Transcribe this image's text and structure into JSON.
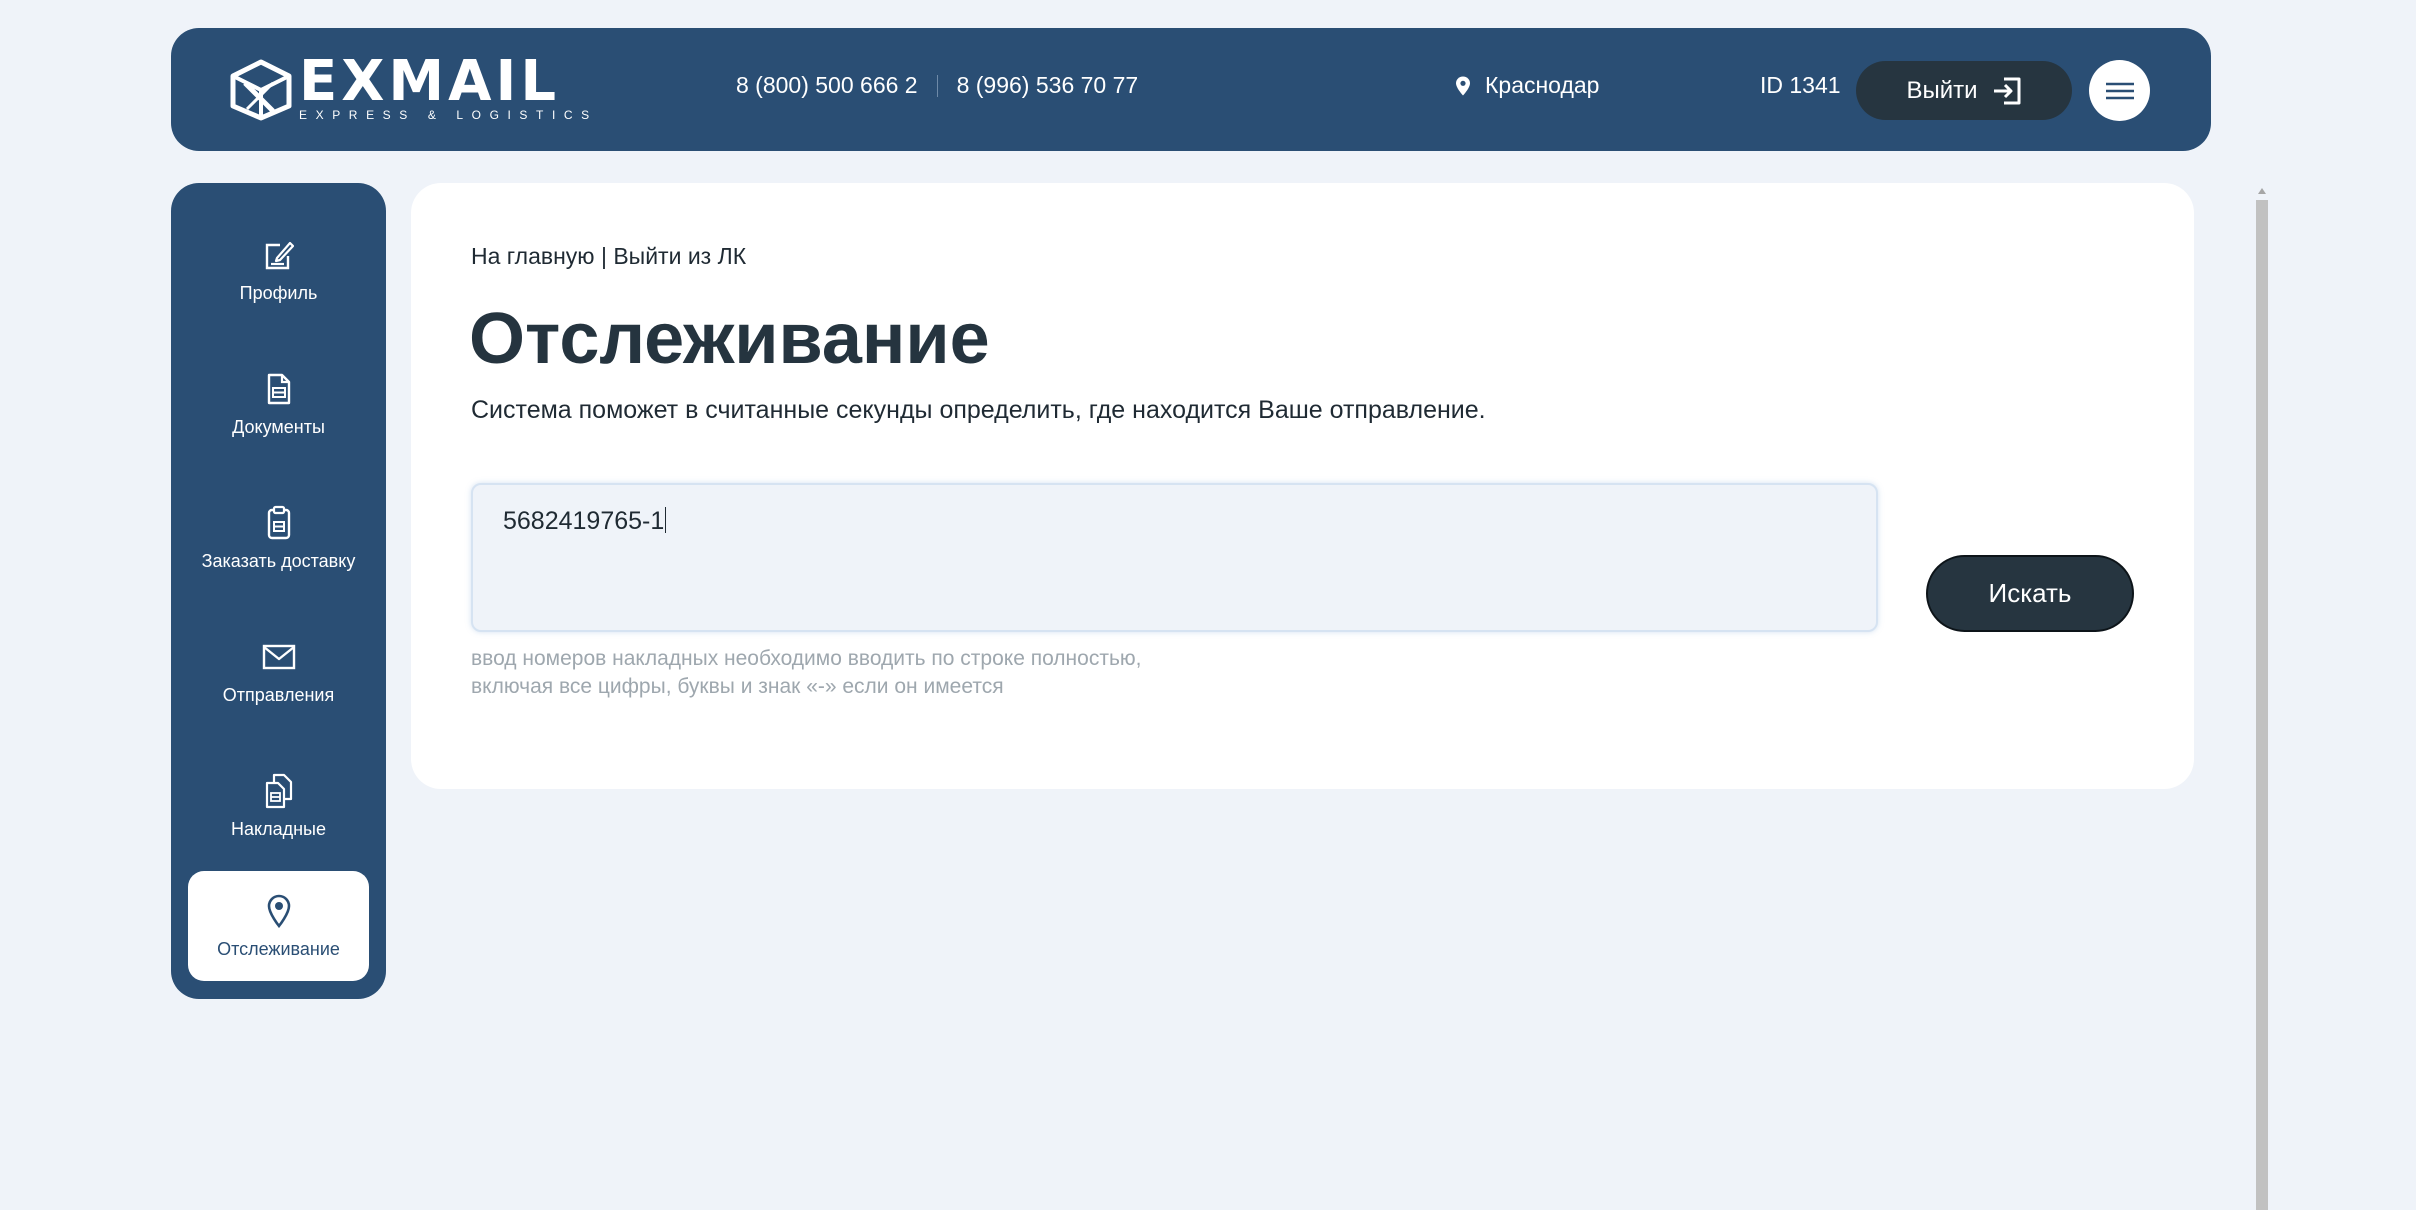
{
  "header": {
    "logo_text": "EXMAIL",
    "logo_subtitle": "EXPRESS & LOGISTICS",
    "phone_1": "8 (800) 500 666 2",
    "phone_2": "8 (996) 536 70 77",
    "city": "Краснодар",
    "user_id": "ID 1341",
    "logout_label": "Выйти",
    "icons": {
      "logo": "box-logo-icon",
      "city": "location-pin-icon",
      "logout": "logout-icon",
      "menu": "hamburger-menu-icon"
    }
  },
  "sidebar": {
    "items": [
      {
        "label": "Профиль",
        "icon": "edit-icon",
        "active": false
      },
      {
        "label": "Документы",
        "icon": "document-icon",
        "active": false
      },
      {
        "label": "Заказать доставку",
        "icon": "clipboard-icon",
        "active": false
      },
      {
        "label": "Отправления",
        "icon": "envelope-icon",
        "active": false
      },
      {
        "label": "Накладные",
        "icon": "invoices-icon",
        "active": false
      },
      {
        "label": "Отслеживание",
        "icon": "location-pin-icon",
        "active": true
      }
    ]
  },
  "main": {
    "breadcrumb_home": "На главную",
    "breadcrumb_sep": "|",
    "breadcrumb_logout": "Выйти из ЛК",
    "title": "Отслеживание",
    "subtitle": "Система поможет в считанные секунды определить, где находится Ваше отправление.",
    "search_value": "5682419765-1",
    "hint_line_1": "ввод номеров накладных необходимо вводить по строке полностью,",
    "hint_line_2": "включая все цифры, буквы и знак «-» если он имеется",
    "search_button": "Искать"
  },
  "colors": {
    "page_bg": "#eff3f9",
    "brand_blue": "#2a4e74",
    "dark_button": "#263540",
    "card_bg": "#ffffff",
    "hint_text": "#9ea7ae"
  }
}
